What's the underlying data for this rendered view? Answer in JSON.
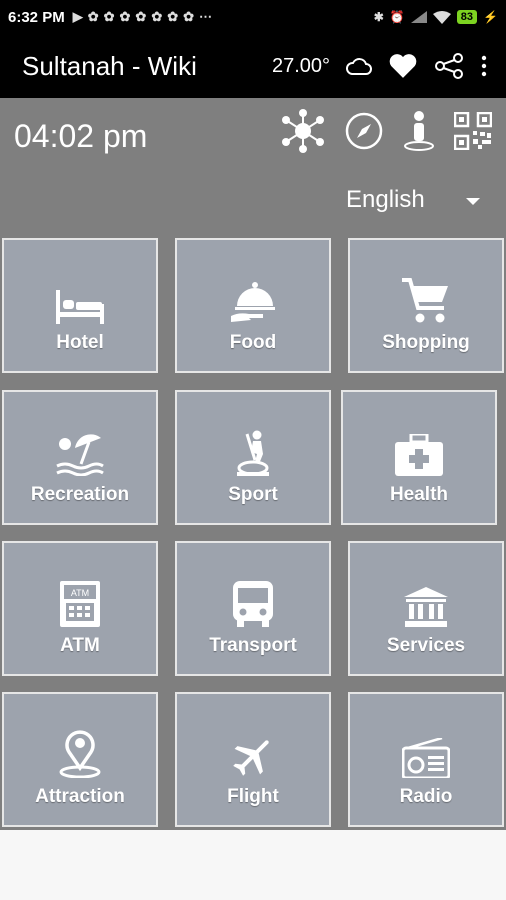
{
  "status_bar": {
    "time": "6:32 PM",
    "notification_icons": [
      "▶",
      "✿",
      "✿",
      "✿",
      "✿",
      "✿",
      "✿",
      "✿",
      "⋯"
    ],
    "battery": "83"
  },
  "app_bar": {
    "title": "Sultanah - Wiki",
    "temperature": "27.00°"
  },
  "header": {
    "clock": "04:02 pm",
    "language": "English"
  },
  "tiles": [
    {
      "label": "Hotel",
      "icon": "bed-icon"
    },
    {
      "label": "Food",
      "icon": "food-cloche-icon"
    },
    {
      "label": "Shopping",
      "icon": "cart-icon"
    },
    {
      "label": "Recreation",
      "icon": "beach-umbrella-icon"
    },
    {
      "label": "Sport",
      "icon": "elliptical-icon"
    },
    {
      "label": "Health",
      "icon": "first-aid-kit-icon"
    },
    {
      "label": "ATM",
      "icon": "atm-icon"
    },
    {
      "label": "Transport",
      "icon": "bus-icon"
    },
    {
      "label": "Services",
      "icon": "bank-building-icon"
    },
    {
      "label": "Attraction",
      "icon": "map-pin-icon"
    },
    {
      "label": "Flight",
      "icon": "airplane-icon"
    },
    {
      "label": "Radio",
      "icon": "radio-icon"
    }
  ],
  "colors": {
    "tile_bg": "#9da3ad",
    "main_bg": "#7f7f7f",
    "battery": "#7dd321"
  }
}
